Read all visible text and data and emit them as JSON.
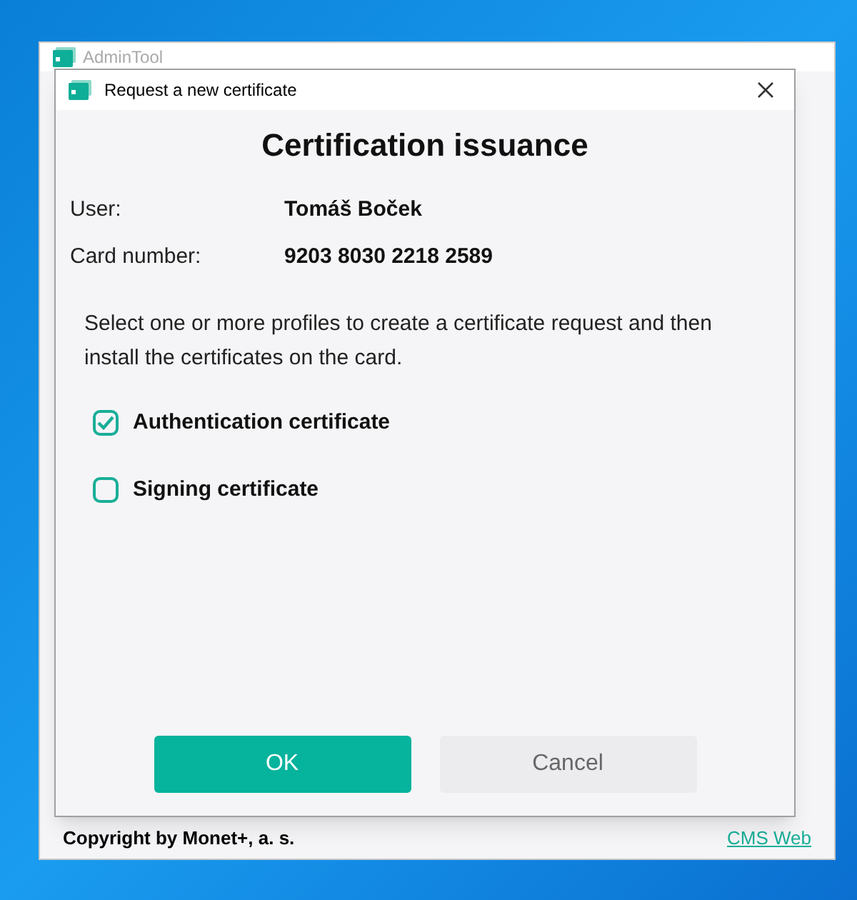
{
  "background_window": {
    "title": "AdminTool",
    "footer": {
      "copyright": "Copyright by Monet+, a. s.",
      "link": "CMS Web"
    }
  },
  "dialog": {
    "title": "Request a new certificate",
    "heading": "Certification issuance",
    "fields": [
      {
        "label": "User:",
        "value": "Tomáš Boček"
      },
      {
        "label": "Card number:",
        "value": "9203 8030 2218 2589"
      }
    ],
    "instructions": "Select one or more profiles to create a certificate request and then install the certificates on the card.",
    "profiles": [
      {
        "label": "Authentication certificate",
        "checked": true
      },
      {
        "label": "Signing certificate",
        "checked": false
      }
    ],
    "buttons": [
      {
        "label": "OK",
        "kind": "primary"
      },
      {
        "label": "Cancel",
        "kind": "secondary"
      }
    ]
  }
}
